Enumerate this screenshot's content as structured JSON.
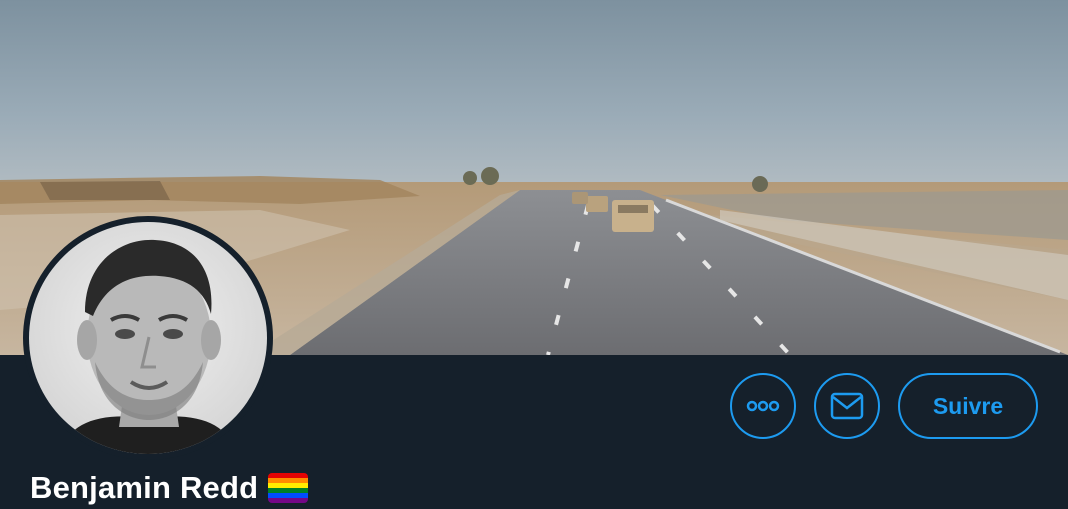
{
  "profile": {
    "display_name": "Benjamin Redd",
    "name_emoji": "rainbow-flag-icon"
  },
  "actions": {
    "more_icon": "more-dots-icon",
    "message_icon": "envelope-icon",
    "follow_label": "Suivre"
  },
  "colors": {
    "background": "#15202b",
    "accent": "#1d9bf0",
    "text": "#ffffff",
    "flag": [
      "#e40303",
      "#ff8c00",
      "#ffed00",
      "#008026",
      "#004dff",
      "#750787"
    ]
  }
}
